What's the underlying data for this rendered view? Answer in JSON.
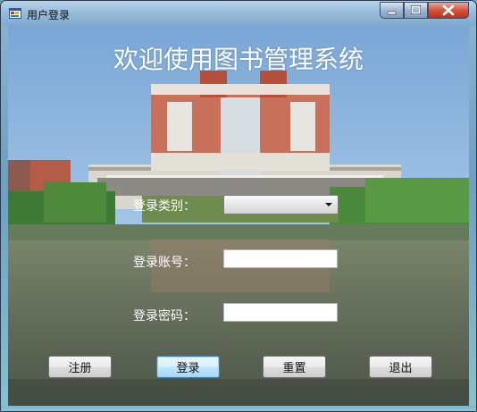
{
  "window": {
    "title": "用户登录",
    "controls": [
      "minimize",
      "maximize",
      "close"
    ]
  },
  "heading": "欢迎使用图书管理系统",
  "form": {
    "type_label": "登录类别：",
    "type_value": "",
    "account_label": "登录账号：",
    "account_value": "",
    "password_label": "登录密码：",
    "password_value": ""
  },
  "buttons": {
    "register": "注册",
    "login": "登录",
    "reset": "重置",
    "exit": "退出"
  },
  "icons": {
    "app": "app-icon",
    "minimize": "minimize-icon",
    "maximize": "maximize-icon",
    "close": "close-icon",
    "dropdown": "chevron-down-icon"
  }
}
